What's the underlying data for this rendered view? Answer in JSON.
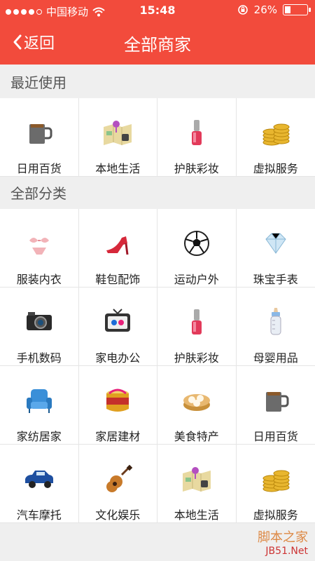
{
  "status_bar": {
    "carrier": "中国移动",
    "time": "15:48",
    "battery": "26%",
    "battery_level": 0.26
  },
  "nav": {
    "back_label": "返回",
    "title": "全部商家"
  },
  "recent": {
    "title": "最近使用",
    "items": [
      {
        "label": "日用百货",
        "icon": "mug-icon"
      },
      {
        "label": "本地生活",
        "icon": "map-pin-icon"
      },
      {
        "label": "护肤彩妆",
        "icon": "nail-polish-icon"
      },
      {
        "label": "虚拟服务",
        "icon": "coins-icon"
      }
    ]
  },
  "all": {
    "title": "全部分类",
    "items": [
      {
        "label": "服装内衣",
        "icon": "bra-icon"
      },
      {
        "label": "鞋包配饰",
        "icon": "high-heel-icon"
      },
      {
        "label": "运动户外",
        "icon": "soccer-ball-icon"
      },
      {
        "label": "珠宝手表",
        "icon": "diamond-icon"
      },
      {
        "label": "手机数码",
        "icon": "camera-icon"
      },
      {
        "label": "家电办公",
        "icon": "tv-icon"
      },
      {
        "label": "护肤彩妆",
        "icon": "nail-polish-icon"
      },
      {
        "label": "母婴用品",
        "icon": "baby-bottle-icon"
      },
      {
        "label": "家纺居家",
        "icon": "armchair-icon"
      },
      {
        "label": "家居建材",
        "icon": "paint-bucket-icon"
      },
      {
        "label": "美食特产",
        "icon": "steamer-icon"
      },
      {
        "label": "日用百货",
        "icon": "mug-icon"
      },
      {
        "label": "汽车摩托",
        "icon": "car-icon"
      },
      {
        "label": "文化娱乐",
        "icon": "guitar-icon"
      },
      {
        "label": "本地生活",
        "icon": "map-pin-icon"
      },
      {
        "label": "虚拟服务",
        "icon": "coins-icon"
      }
    ]
  },
  "watermark": {
    "line1": "脚本之家",
    "line2": "JB51.Net"
  }
}
